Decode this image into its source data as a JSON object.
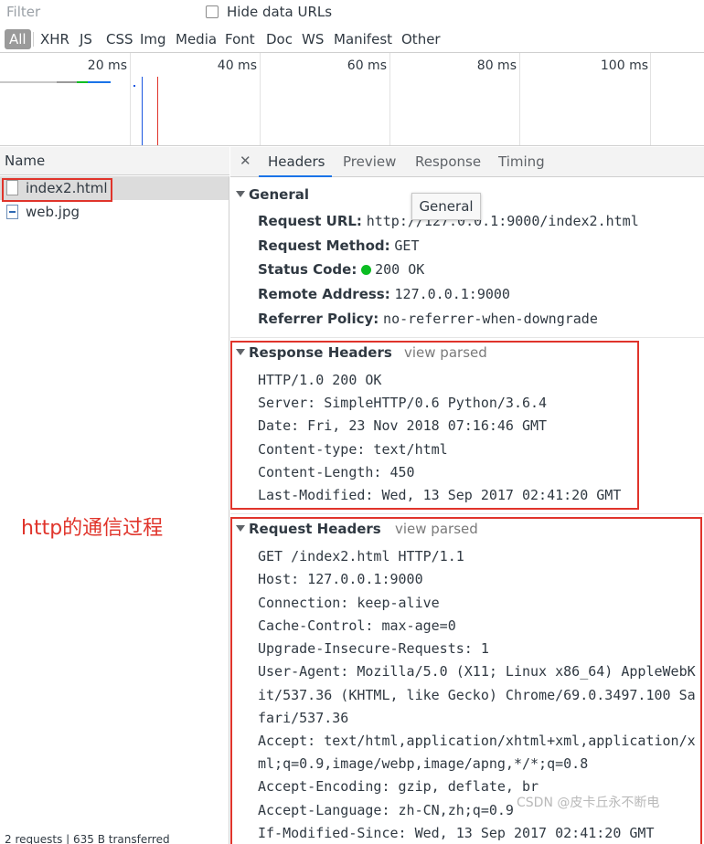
{
  "toolbar": {
    "filter_placeholder": "Filter",
    "hide_data_urls_label": "Hide data URLs",
    "type_filters": [
      "All",
      "XHR",
      "JS",
      "CSS",
      "Img",
      "Media",
      "Font",
      "Doc",
      "WS",
      "Manifest",
      "Other"
    ]
  },
  "overview": {
    "tick_labels": [
      "20 ms",
      "40 ms",
      "60 ms",
      "80 ms",
      "100 ms"
    ],
    "marker_colors": {
      "dom_content_loaded": "#1a56e0",
      "load": "#e0342b",
      "waiting": "#0bbd22",
      "queue": "#b0b0b0"
    }
  },
  "request_list": {
    "column_header": "Name",
    "items": [
      {
        "name": "index2.html",
        "icon": "document-icon",
        "selected": true
      },
      {
        "name": "web.jpg",
        "icon": "image-icon",
        "selected": false
      }
    ],
    "summary": "2 requests | 635 B transferred"
  },
  "annotation": "http的通信过程",
  "details": {
    "tabs": [
      "Headers",
      "Preview",
      "Response",
      "Timing"
    ],
    "active_tab": "Headers",
    "tooltip": "General",
    "general": {
      "title": "General",
      "rows": [
        {
          "key": "Request URL:",
          "value": "http://127.0.0.1:9000/index2.html"
        },
        {
          "key": "Request Method:",
          "value": "GET"
        },
        {
          "key": "Status Code:",
          "value": "200 OK"
        },
        {
          "key": "Remote Address:",
          "value": "127.0.0.1:9000"
        },
        {
          "key": "Referrer Policy:",
          "value": "no-referrer-when-downgrade"
        }
      ]
    },
    "response_headers": {
      "title": "Response Headers",
      "view_parsed": "view parsed",
      "lines": [
        "HTTP/1.0 200 OK",
        "Server: SimpleHTTP/0.6 Python/3.6.4",
        "Date: Fri, 23 Nov 2018 07:16:46 GMT",
        "Content-type: text/html",
        "Content-Length: 450",
        "Last-Modified: Wed, 13 Sep 2017 02:41:20 GMT"
      ]
    },
    "request_headers": {
      "title": "Request Headers",
      "view_parsed": "view parsed",
      "lines": [
        "GET /index2.html HTTP/1.1",
        "Host: 127.0.0.1:9000",
        "Connection: keep-alive",
        "Cache-Control: max-age=0",
        "Upgrade-Insecure-Requests: 1",
        "User-Agent: Mozilla/5.0 (X11; Linux x86_64) AppleWebK",
        "it/537.36 (KHTML, like Gecko) Chrome/69.0.3497.100 Sa",
        "fari/537.36",
        "Accept: text/html,application/xhtml+xml,application/x",
        "ml;q=0.9,image/webp,image/apng,*/*;q=0.8",
        "Accept-Encoding: gzip, deflate, br",
        "Accept-Language: zh-CN,zh;q=0.9",
        "If-Modified-Since: Wed, 13 Sep 2017 02:41:20 GMT"
      ]
    }
  },
  "watermark": "CSDN @皮卡丘永不断电",
  "accent_colors": {
    "annotation_red": "#e0342b",
    "active_tab_blue": "#1a73e8",
    "status_green": "#0bbd22"
  }
}
